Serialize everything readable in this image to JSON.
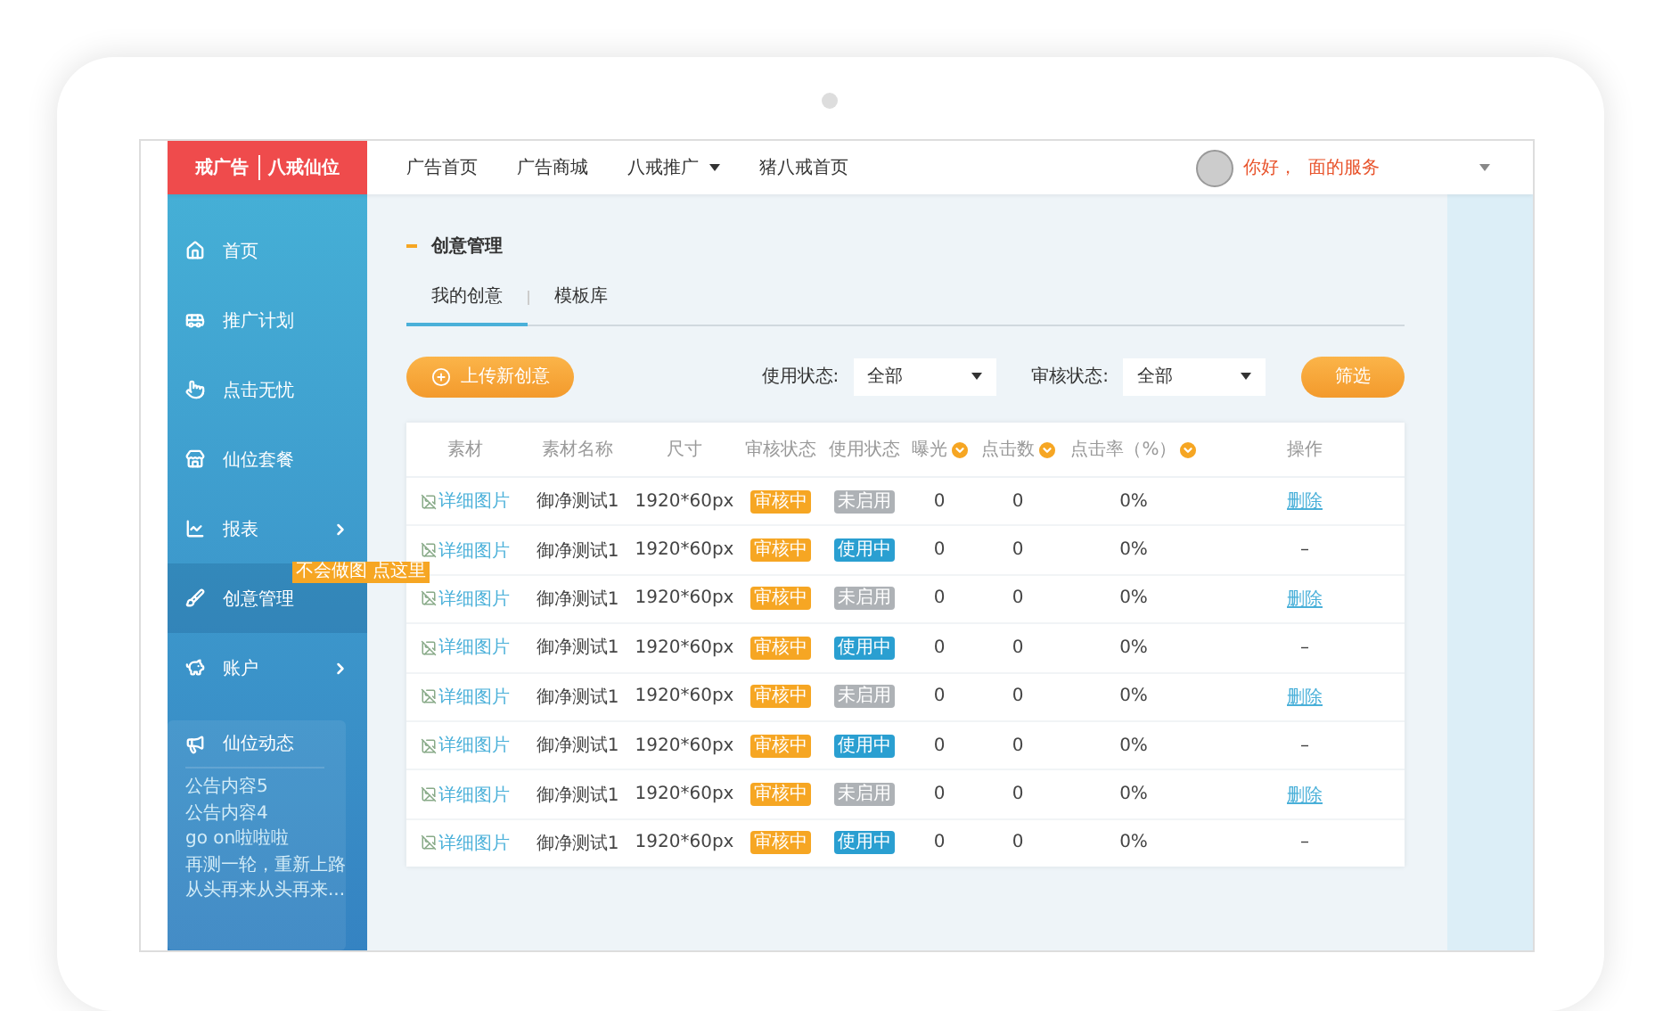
{
  "logo": {
    "left": "戒广告",
    "right": "八戒仙位"
  },
  "nav": [
    {
      "label": "广告首页",
      "dropdown": false
    },
    {
      "label": "广告商城",
      "dropdown": false
    },
    {
      "label": "八戒推广",
      "dropdown": true
    },
    {
      "label": "猪八戒首页",
      "dropdown": false
    }
  ],
  "user": {
    "greeting": "你好，  面的服务"
  },
  "sidebar": {
    "items": [
      {
        "label": "首页",
        "kind": "home",
        "selected": false,
        "submenu": false
      },
      {
        "label": "推广计划",
        "kind": "bus",
        "selected": false,
        "submenu": false
      },
      {
        "label": "点击无忧",
        "kind": "hand",
        "selected": false,
        "submenu": false
      },
      {
        "label": "仙位套餐",
        "kind": "store",
        "selected": false,
        "submenu": false
      },
      {
        "label": "报表",
        "kind": "chart",
        "selected": false,
        "submenu": true
      },
      {
        "label": "创意管理",
        "kind": "brush",
        "selected": true,
        "submenu": false,
        "badge": "不会做图 点这里"
      },
      {
        "label": "账户",
        "kind": "piggy",
        "selected": false,
        "submenu": true
      }
    ],
    "news": {
      "title": "仙位动态",
      "items": [
        "公告内容5",
        "公告内容4",
        "go on啦啦啦",
        "再测一轮，重新上路",
        "从头再来从头再来..."
      ]
    }
  },
  "page_title": "创意管理",
  "tabs": [
    {
      "label": "我的创意",
      "selected": true
    },
    {
      "label": "模板库",
      "selected": false
    }
  ],
  "upload_button": "上传新创意",
  "filters": [
    {
      "label": "使用状态:",
      "value": "全部"
    },
    {
      "label": "审核状态:",
      "value": "全部"
    }
  ],
  "filter_button": "筛选",
  "table": {
    "columns": [
      {
        "label": "素材",
        "sortable": false
      },
      {
        "label": "素材名称",
        "sortable": false
      },
      {
        "label": "尺寸",
        "sortable": false
      },
      {
        "label": "审核状态",
        "sortable": false
      },
      {
        "label": "使用状态",
        "sortable": false
      },
      {
        "label": "曝光",
        "sortable": true
      },
      {
        "label": "点击数",
        "sortable": true
      },
      {
        "label": "点击率（%）",
        "sortable": true
      },
      {
        "label": "操作",
        "sortable": false
      }
    ],
    "rows": [
      {
        "image": "详细图片",
        "name": "御净测试1",
        "size": "1920*60px",
        "review": "审核中",
        "usage": {
          "label": "未启用",
          "active": false
        },
        "views": "0",
        "clicks": "0",
        "rate": "0%",
        "action": {
          "kind": "link",
          "label": "删除"
        }
      },
      {
        "image": "详细图片",
        "name": "御净测试1",
        "size": "1920*60px",
        "review": "审核中",
        "usage": {
          "label": "使用中",
          "active": true
        },
        "views": "0",
        "clicks": "0",
        "rate": "0%",
        "action": {
          "kind": "dash",
          "label": "–"
        }
      },
      {
        "image": "详细图片",
        "name": "御净测试1",
        "size": "1920*60px",
        "review": "审核中",
        "usage": {
          "label": "未启用",
          "active": false
        },
        "views": "0",
        "clicks": "0",
        "rate": "0%",
        "action": {
          "kind": "link",
          "label": "删除"
        }
      },
      {
        "image": "详细图片",
        "name": "御净测试1",
        "size": "1920*60px",
        "review": "审核中",
        "usage": {
          "label": "使用中",
          "active": true
        },
        "views": "0",
        "clicks": "0",
        "rate": "0%",
        "action": {
          "kind": "dash",
          "label": "–"
        }
      },
      {
        "image": "详细图片",
        "name": "御净测试1",
        "size": "1920*60px",
        "review": "审核中",
        "usage": {
          "label": "未启用",
          "active": false
        },
        "views": "0",
        "clicks": "0",
        "rate": "0%",
        "action": {
          "kind": "link",
          "label": "删除"
        }
      },
      {
        "image": "详细图片",
        "name": "御净测试1",
        "size": "1920*60px",
        "review": "审核中",
        "usage": {
          "label": "使用中",
          "active": true
        },
        "views": "0",
        "clicks": "0",
        "rate": "0%",
        "action": {
          "kind": "dash",
          "label": "–"
        }
      },
      {
        "image": "详细图片",
        "name": "御净测试1",
        "size": "1920*60px",
        "review": "审核中",
        "usage": {
          "label": "未启用",
          "active": false
        },
        "views": "0",
        "clicks": "0",
        "rate": "0%",
        "action": {
          "kind": "link",
          "label": "删除"
        }
      },
      {
        "image": "详细图片",
        "name": "御净测试1",
        "size": "1920*60px",
        "review": "审核中",
        "usage": {
          "label": "使用中",
          "active": true
        },
        "views": "0",
        "clicks": "0",
        "rate": "0%",
        "action": {
          "kind": "dash",
          "label": "–"
        }
      }
    ]
  }
}
